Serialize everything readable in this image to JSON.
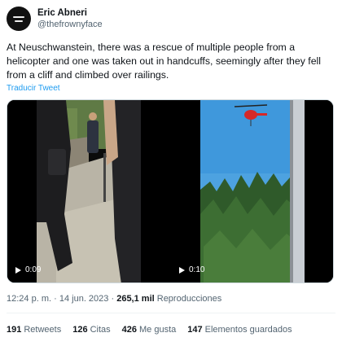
{
  "author": {
    "display_name": "Eric Abneri",
    "handle": "@thefrownyface"
  },
  "tweet": {
    "text": "At Neuschwanstein, there was a rescue of multiple people from a helicopter and one was taken out in handcuffs, seemingly after they fell from a cliff and climbed over railings.",
    "translate_label": "Traducir Tweet"
  },
  "media": {
    "videos": [
      {
        "duration": "0:09"
      },
      {
        "duration": "0:10"
      }
    ]
  },
  "meta": {
    "time": "12:24 p. m.",
    "separator": "·",
    "date": "14 jun. 2023",
    "views_count": "265,1 mil",
    "views_label": "Reproducciones"
  },
  "stats": {
    "retweets": {
      "count": "191",
      "label": "Retweets"
    },
    "quotes": {
      "count": "126",
      "label": "Citas"
    },
    "likes": {
      "count": "426",
      "label": "Me gusta"
    },
    "bookmarks": {
      "count": "147",
      "label": "Elementos guardados"
    }
  },
  "colors": {
    "link": "#1d9bf0",
    "secondary_text": "#536471",
    "primary_text": "#0f1419",
    "helicopter": "#d62828"
  }
}
